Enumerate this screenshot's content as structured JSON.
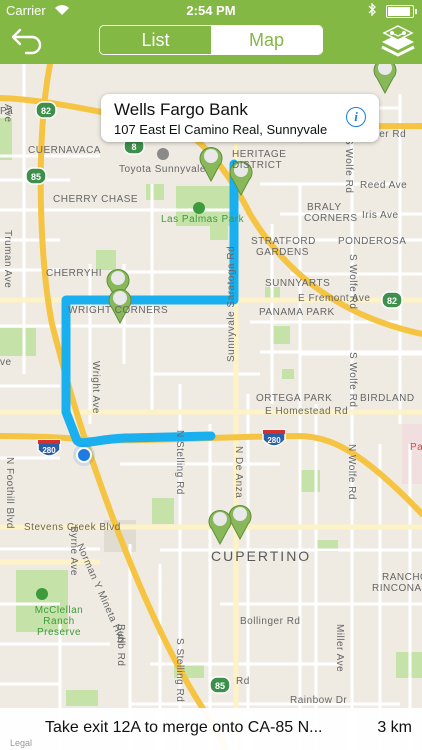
{
  "status_bar": {
    "carrier": "Carrier",
    "time": "2:54 PM",
    "battery_level": 0.9
  },
  "nav": {
    "tabs": [
      {
        "label": "List",
        "selected": false
      },
      {
        "label": "Map",
        "selected": true
      }
    ]
  },
  "colors": {
    "brand_green": "#84b844",
    "route_blue": "#1ab0f0",
    "pin_green": "#88b85a",
    "location_blue": "#1e7be0"
  },
  "callout": {
    "title": "Wells Fargo Bank",
    "address": "107 East El Camino Real, Sunnyvale"
  },
  "map": {
    "labels": {
      "cuernavaca": "CUERNAVACA",
      "toyota": "Toyota Sunnyvale",
      "cherry_chase": "CHERRY CHASE",
      "las_palmas": "Las Palmas Park",
      "braly": "BRALY",
      "corners": "CORNERS",
      "iris": "Iris Ave",
      "reed": "Reed Ave",
      "ponderosa": "PONDEROSA",
      "stratford": "STRATFORD",
      "gardens": "GARDENS",
      "sunnyarts": "SUNNYARTS",
      "fremont": "E Fremont Ave",
      "panama": "PANAMA PARK",
      "cherryhill": "CHERRYHI",
      "wright_corners": "WRIGHT   CORNERS",
      "wright_ave": "Wright Ave",
      "saratoga": "Sunnyvale Saratoga Rd",
      "ortega": "ORTEGA PARK",
      "birdland": "BIRDLAND",
      "homestead": "E Homestead Rd",
      "wolfe_top": "S Wolfe Rd",
      "wolfe_mid": "S Wolfe Rd",
      "truman": "Truman Ave",
      "stevens": "Stevens Creek Blvd",
      "foothill": "N Foothill Blvd",
      "byrne": "Byrne Ave",
      "mineta": "Norman Y Mineta Hwy",
      "stelling_top": "N Stelling Rd",
      "stelling_bot": "S Stelling Rd",
      "deanza": "N De Anza",
      "wolfe_bot": "N Wolfe Rd",
      "cupertino": "CUPERTINO",
      "rancho": "RANCHO",
      "rinconada": "RINCONADA",
      "mcclellan": "McClellan Ranch Preserve",
      "bollinger": "Bollinger Rd",
      "bubb": "Bubb Rd",
      "miller": "Miller Ave",
      "rainbow": "Rainbow Dr",
      "tifer": "Tifer Rd",
      "pa": "Pa",
      "ave": "Ave",
      "ve": "ve",
      "rd": "Rd",
      "heritage": "HERITAGE",
      "district": "DISTRICT"
    },
    "shields": {
      "s82_top": "82",
      "s82_right": "82",
      "s85_top": "85",
      "s85_bottom": "85",
      "s280_left": "280",
      "s280_mid": "280",
      "s8": "8"
    }
  },
  "bottom_bar": {
    "instruction": "Take exit 12A to merge onto CA-85 N...",
    "distance": "3 km",
    "legal": "Legal"
  }
}
